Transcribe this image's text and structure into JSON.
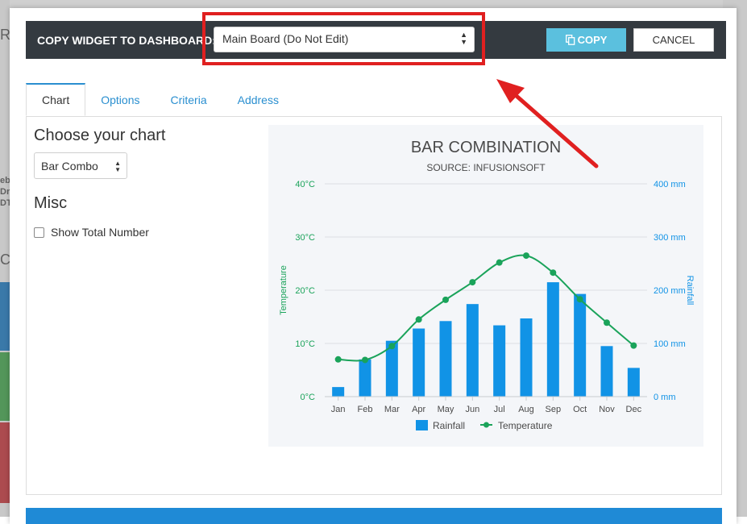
{
  "background": {
    "fragments": [
      "R",
      "eb",
      "Dr",
      "DTc",
      "CC"
    ]
  },
  "modal": {
    "copy_label": "COPY WIDGET TO DASHBOARD:",
    "dashboard_select": {
      "value": "Main Board (Do Not Edit)"
    },
    "copy_button": "COPY",
    "cancel_button": "CANCEL"
  },
  "tabs": [
    {
      "label": "Chart",
      "active": true
    },
    {
      "label": "Options",
      "active": false
    },
    {
      "label": "Criteria",
      "active": false
    },
    {
      "label": "Address",
      "active": false
    }
  ],
  "chart_tab": {
    "choose_title": "Choose your chart",
    "chart_type_select": {
      "value": "Bar Combo"
    },
    "misc_title": "Misc",
    "show_total_label": "Show Total Number",
    "show_total_checked": false
  },
  "colors": {
    "rainfall": "#1193e6",
    "temperature": "#1aa35a",
    "highlight": "#e02020"
  },
  "chart_data": {
    "type": "bar",
    "title": "BAR COMBINATION",
    "subtitle": "SOURCE: INFUSIONSOFT",
    "categories": [
      "Jan",
      "Feb",
      "Mar",
      "Apr",
      "May",
      "Jun",
      "Jul",
      "Aug",
      "Sep",
      "Oct",
      "Nov",
      "Dec"
    ],
    "series": [
      {
        "name": "Rainfall",
        "type": "bar",
        "axis": "right",
        "values": [
          18,
          70,
          105,
          128,
          142,
          174,
          134,
          147,
          215,
          193,
          95,
          54
        ]
      },
      {
        "name": "Temperature",
        "type": "line",
        "axis": "left",
        "values": [
          7.0,
          6.9,
          9.5,
          14.5,
          18.2,
          21.5,
          25.2,
          26.5,
          23.3,
          18.3,
          13.9,
          9.6
        ]
      }
    ],
    "left_axis": {
      "label": "Temperature",
      "ticks": [
        "0°C",
        "10°C",
        "20°C",
        "30°C",
        "40°C"
      ],
      "range": [
        0,
        40
      ]
    },
    "right_axis": {
      "label": "Rainfall",
      "ticks": [
        "0 mm",
        "100 mm",
        "200 mm",
        "300 mm",
        "400 mm"
      ],
      "range": [
        0,
        400
      ]
    },
    "legend": "bottom",
    "grid": true
  }
}
